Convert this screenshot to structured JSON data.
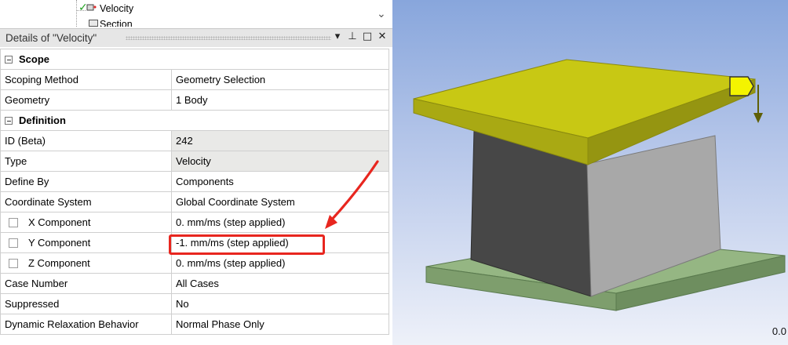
{
  "tree": {
    "velocity_label": "Velocity",
    "section_label": "Section"
  },
  "details": {
    "title": "Details of \"Velocity\"",
    "icons": [
      "dropdown-icon",
      "pin-icon",
      "maximize-icon",
      "close-icon"
    ]
  },
  "groups": {
    "scope": "Scope",
    "definition": "Definition"
  },
  "rows": {
    "scoping_method": {
      "name": "Scoping Method",
      "value": "Geometry Selection"
    },
    "geometry": {
      "name": "Geometry",
      "value": "1 Body"
    },
    "id": {
      "name": "ID (Beta)",
      "value": "242"
    },
    "type": {
      "name": "Type",
      "value": "Velocity"
    },
    "define_by": {
      "name": "Define By",
      "value": "Components"
    },
    "coord_system": {
      "name": "Coordinate System",
      "value": "Global Coordinate System"
    },
    "x_component": {
      "name": "X Component",
      "value": "0. mm/ms  (step applied)"
    },
    "y_component": {
      "name": "Y Component",
      "value": "-1. mm/ms  (step applied)"
    },
    "z_component": {
      "name": "Z Component",
      "value": "0. mm/ms  (step applied)"
    },
    "case_number": {
      "name": "Case Number",
      "value": "All Cases"
    },
    "suppressed": {
      "name": "Suppressed",
      "value": "No"
    },
    "dynamic_relaxation": {
      "name": "Dynamic Relaxation Behavior",
      "value": "Normal Phase Only"
    }
  },
  "viewport": {
    "scale_label": "0.0",
    "top_label": "",
    "colors": {
      "top_plate": "#c8c814",
      "base_plate": "#8fb07c",
      "block_dark": "#474747",
      "block_light": "#a8a8a8",
      "highlight": "#e8261f"
    }
  }
}
